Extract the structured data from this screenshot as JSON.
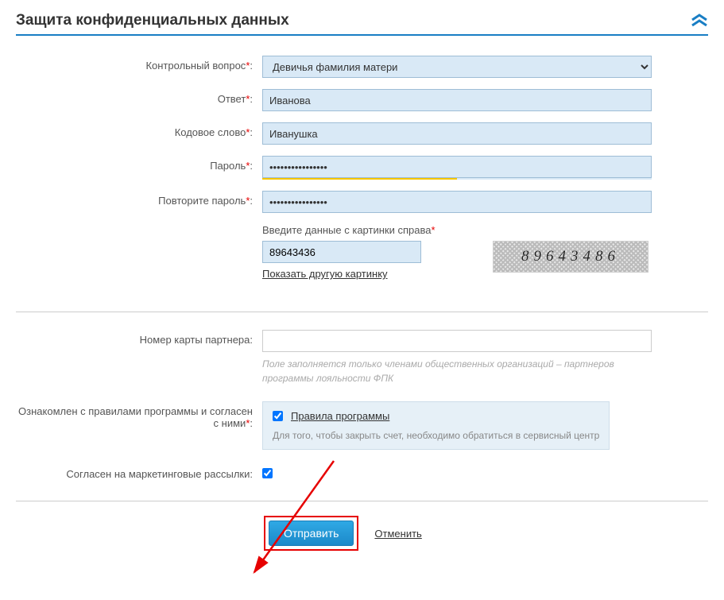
{
  "section": {
    "title": "Защита конфиденциальных данных"
  },
  "labels": {
    "security_question": "Контрольный вопрос",
    "answer": "Ответ",
    "code_word": "Кодовое слово",
    "password": "Пароль",
    "password_repeat": "Повторите пароль",
    "captcha_prompt": "Введите данные с картинки справа",
    "captcha_refresh": "Показать другую картинку",
    "partner_card": "Номер карты партнера:",
    "partner_hint": "Поле заполняется только членами общественных организаций – партнеров программы лояльности ФПК",
    "rules_agree": "Ознакомлен с правилами программы и согласен с ними",
    "rules_link": "Правила программы",
    "rules_note": "Для того, чтобы закрыть счет, необходимо обратиться в сервисный центр",
    "marketing": "Согласен на маркетинговые рассылки:"
  },
  "values": {
    "security_question": "Девичья фамилия матери",
    "answer": "Иванова",
    "code_word": "Иванушка",
    "password": "••••••••••••••••",
    "password_repeat": "••••••••••••••••",
    "captcha": "89643436",
    "captcha_image_text": "89643486",
    "partner_card": "",
    "rules_checked": true,
    "marketing_checked": true
  },
  "buttons": {
    "submit": "Отправить",
    "cancel": "Отменить"
  }
}
